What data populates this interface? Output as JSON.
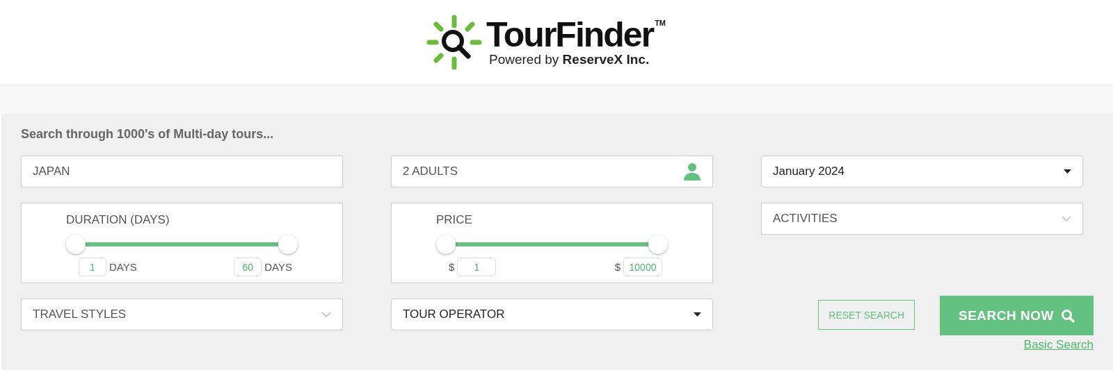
{
  "logo": {
    "name": "TourFinder",
    "trademark": "TM",
    "tagline": "Powered by **ReserveX Inc.**"
  },
  "search": {
    "heading": "Search through 1000's of Multi-day tours...",
    "destination": {
      "value": "JAPAN"
    },
    "travellers": {
      "value": "2 ADULTS"
    },
    "month": {
      "value": "January 2024"
    },
    "duration": {
      "label": "DURATION (DAYS)",
      "thumbs": [
        {
          "level": 0
        },
        {
          "level": 1
        }
      ],
      "min": {
        "value": "1",
        "unit": "DAYS"
      },
      "max": {
        "value": "60",
        "unit": "DAYS"
      }
    },
    "price": {
      "label": "PRICE",
      "thumbs": [
        {
          "level": 0
        },
        {
          "level": 1
        }
      ],
      "min": {
        "value": "1",
        "currency": "$"
      },
      "max": {
        "value": "10000",
        "currency": "$"
      }
    },
    "activities": {
      "placeholder": "ACTIVITIES"
    },
    "travel_styles": {
      "placeholder": "TRAVEL STYLES"
    },
    "tour_operator": {
      "value": "TOUR OPERATOR"
    },
    "reset_button": "RESET SEARCH",
    "search_button": "SEARCH NOW",
    "basic_search_link": "Basic Search"
  }
}
